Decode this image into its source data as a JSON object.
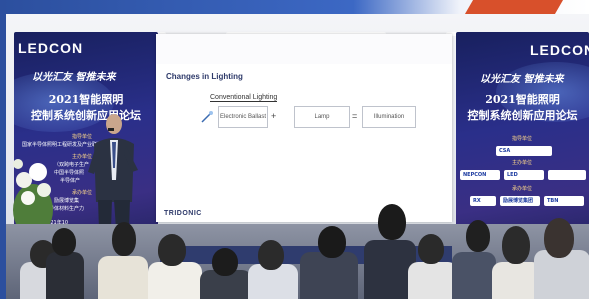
{
  "banner_left": {
    "brand": "LEDCON",
    "slogan": "以光汇友 智推未来",
    "title_line1": "2021智能照明",
    "title_line2": "控制系统创新应用论坛",
    "org_heading": "指导单位",
    "org_line": "国家半导体照明工程研发及产业联盟（CSA）",
    "host_heading": "主办单位",
    "host_line1": "（双跨电子生产",
    "host_line2": "中国半导体照",
    "host_line3": "半导体产",
    "support_heading": "承办单位",
    "support_line1": "励展博览集",
    "support_line2": "半导体材料生产力",
    "date_text": "2021年10"
  },
  "banner_right": {
    "brand": "LEDCON",
    "slogan": "以光汇友 智推未来",
    "title_line1": "2021智能照明",
    "title_line2": "控制系统创新应用论坛",
    "org_heading": "指导单位",
    "host_heading": "主办单位",
    "support_heading": "承办单位",
    "logos": [
      "CSA",
      "NEPCON",
      "LED",
      "RX",
      "励展博览集团",
      "TBN"
    ]
  },
  "slide": {
    "title": "Changes in Lighting",
    "subtitle": "Conventional Lighting",
    "box_ballast": "Electronic Ballast",
    "box_lamp": "Lamp",
    "box_illumination": "Illumination",
    "op_plus": "+",
    "op_equals": "=",
    "brand": "TRIDONIC"
  },
  "colors": {
    "frame_blue": "#2c4f9e",
    "frame_accent": "#d8502b",
    "banner_navy": "#232a7a",
    "slide_text": "#2e3a6a"
  }
}
